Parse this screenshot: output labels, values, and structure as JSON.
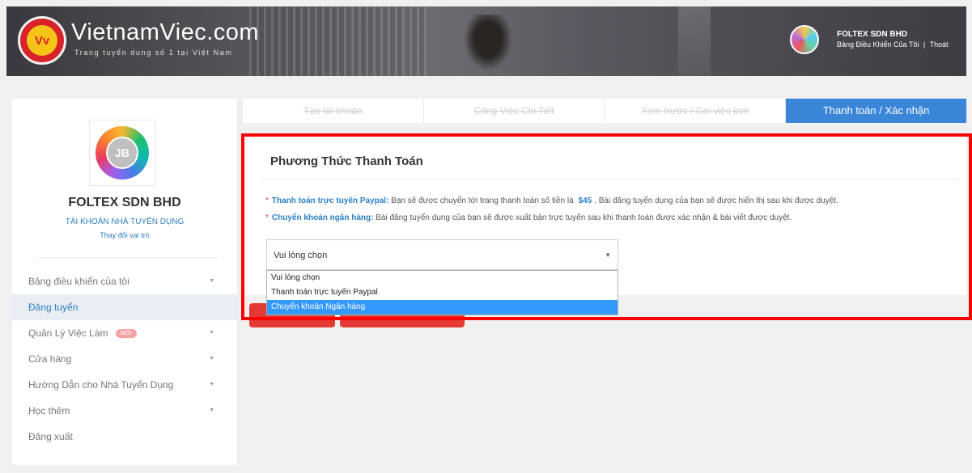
{
  "header": {
    "logo_mark": "Vv",
    "site_name": "VietnamViec.com",
    "tagline": "Trang tuyển dụng số 1 tại Việt Nam",
    "company": "FOLTEX SDN BHD",
    "dashboard_link": "Bảng Điều Khiển Của Tôi",
    "separator": "|",
    "logout_link": "Thoát"
  },
  "sidebar": {
    "avatar_initials": "JB",
    "company": "FOLTEX SDN BHD",
    "role": "TÀI KHOẢN NHÀ TUYỂN DỤNG",
    "change_role": "Thay đổi vai trò",
    "items": [
      {
        "label": "Bảng điều khiển của tôi",
        "caret": "▼"
      },
      {
        "label": "Đăng tuyển"
      },
      {
        "label": "Quản Lý Việc Làm",
        "badge": "MỚI",
        "caret": "▼"
      },
      {
        "label": "Cửa hàng",
        "caret": "▼"
      },
      {
        "label": "Hướng Dẫn cho Nhà Tuyển Dụng",
        "caret": "▼"
      },
      {
        "label": "Học thêm",
        "caret": "▼"
      },
      {
        "label": "Đăng xuất"
      }
    ]
  },
  "tabs": [
    {
      "label": "Tạo tài khoản"
    },
    {
      "label": "Công Việc Chi Tiết"
    },
    {
      "label": "Xem trước / Gói việc làm"
    },
    {
      "label": "Thanh toán / Xác nhận"
    }
  ],
  "payment": {
    "title": "Phương Thức Thanh Toán",
    "star": "*",
    "paypal_label": "Thanh toán trực tuyến Paypal:",
    "paypal_text_before": "Bạn sẽ được chuyển tới trang thanh toán số tiền là",
    "paypal_price": "$45",
    "paypal_text_after": ". Bài đăng tuyển dụng của bạn sẽ được hiển thị sau khi được duyệt.",
    "bank_label": "Chuyển khoản ngân hàng:",
    "bank_text": "Bài đăng tuyển dụng của bạn sẽ được xuất bản trực tuyến sau khi thanh toán được xác nhận & bài viết được duyệt.",
    "select_value": "Vui lòng chọn",
    "select_arrow": "▼",
    "options": [
      {
        "label": "Vui lòng chọn"
      },
      {
        "label": "Thanh toán trực tuyến Paypal"
      },
      {
        "label": "Chuyển khoản Ngân hàng"
      }
    ]
  },
  "colors": {
    "accent": "#3a86d9",
    "link": "#2d7fc3",
    "button": "#e53935",
    "highlight": "#ff0000"
  }
}
